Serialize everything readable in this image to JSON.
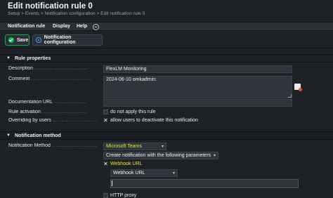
{
  "header": {
    "title": "Edit notification rule 0",
    "breadcrumb": "Setup > Events > Notification configuration > Edit notification rule 0"
  },
  "menu": {
    "items": [
      "Notification rule",
      "Display",
      "Help"
    ]
  },
  "toolbar": {
    "save_label": "Save",
    "notification_config_label": "Notification configuration"
  },
  "rule_properties": {
    "heading": "Rule properties",
    "description_label": "Description",
    "description_value": "FlexLM Monitoring",
    "comment_label": "Comment",
    "comment_value": "2024-06-10 omkadmin:",
    "documentation_label": "Documentation URL",
    "documentation_value": "",
    "rule_activation_label": "Rule activation",
    "rule_activation_checkbox": "do not apply this rule",
    "overriding_label": "Overriding by users",
    "overriding_checkbox": "allow users to deactivate this notification"
  },
  "notification_method": {
    "heading": "Notification method",
    "method_label": "Notification Method",
    "method_value": "Microsoft Teams",
    "create_value": "Create notification with the following parameters",
    "webhook_checkbox": "Webhook URL",
    "webhook_select": "Webhook URL",
    "webhook_input": "",
    "http_proxy_label": "HTTP proxy"
  },
  "colors": {
    "accent_green": "#16b851",
    "highlight_yellow": "#e8e23a",
    "background": "#1e2227"
  }
}
